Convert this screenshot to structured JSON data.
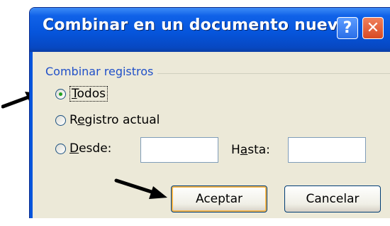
{
  "dialog": {
    "title": "Combinar en un documento nuevo",
    "help_button": "?",
    "close_button": "✕"
  },
  "group": {
    "label": "Combinar registros"
  },
  "options": [
    {
      "label_prefix": "",
      "label_underlined": "T",
      "label_suffix": "odos",
      "checked": true
    },
    {
      "label_prefix": "R",
      "label_underlined": "e",
      "label_suffix": "gistro actual",
      "checked": false
    },
    {
      "label_prefix": "",
      "label_underlined": "D",
      "label_suffix": "esde:",
      "checked": false
    }
  ],
  "range": {
    "desde_value": "",
    "hasta_prefix": "H",
    "hasta_underlined": "a",
    "hasta_suffix": "sta:",
    "hasta_value": ""
  },
  "buttons": {
    "accept": "Aceptar",
    "cancel": "Cancelar"
  },
  "colors": {
    "title_bar": "#0655dc",
    "close_red": "#d84a23",
    "group_label": "#2050c8",
    "dialog_bg": "#ece9d8"
  },
  "icons": {
    "pointer": "black-arrow-icon"
  }
}
